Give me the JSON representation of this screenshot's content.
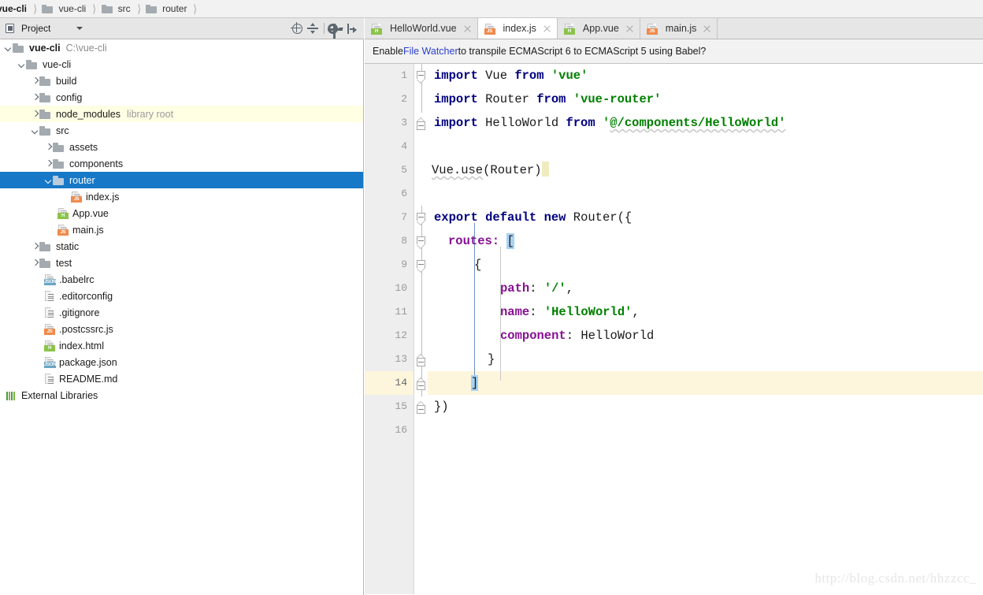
{
  "breadcrumb": {
    "items": [
      {
        "label": "vue-cli",
        "icon": "folder-icon",
        "root": true
      },
      {
        "label": "vue-cli",
        "icon": "folder-icon",
        "root": false
      },
      {
        "label": "src",
        "icon": "folder-icon",
        "root": false
      },
      {
        "label": "router",
        "icon": "folder-icon",
        "root": false
      }
    ]
  },
  "project_panel": {
    "title": "Project",
    "icons": {
      "panel": "project-panel-icon",
      "dropdown": "chevron-down-icon",
      "locate": "locate-target-icon",
      "collapse_all": "collapse-all-icon",
      "settings": "gear-icon",
      "settings_caret": "chevron-down-icon",
      "hide": "hide-panel-icon"
    },
    "tree": [
      {
        "label": "vue-cli",
        "note": "C:\\vue-cli",
        "indent": 0,
        "chevron": "down",
        "icon": "folder-icon",
        "bold": true,
        "state": "normal"
      },
      {
        "label": "vue-cli",
        "note": "",
        "indent": 1,
        "chevron": "down",
        "icon": "folder-icon",
        "bold": false,
        "state": "normal"
      },
      {
        "label": "build",
        "note": "",
        "indent": 2,
        "chevron": "right",
        "icon": "folder-icon",
        "bold": false,
        "state": "normal"
      },
      {
        "label": "config",
        "note": "",
        "indent": 2,
        "chevron": "right",
        "icon": "folder-icon",
        "bold": false,
        "state": "normal"
      },
      {
        "label": "node_modules",
        "note": "library root",
        "indent": 2,
        "chevron": "right",
        "icon": "folder-icon",
        "bold": false,
        "state": "tinted"
      },
      {
        "label": "src",
        "note": "",
        "indent": 2,
        "chevron": "down",
        "icon": "folder-icon",
        "bold": false,
        "state": "normal"
      },
      {
        "label": "assets",
        "note": "",
        "indent": 3,
        "chevron": "right",
        "icon": "folder-icon",
        "bold": false,
        "state": "normal"
      },
      {
        "label": "components",
        "note": "",
        "indent": 3,
        "chevron": "right",
        "icon": "folder-icon",
        "bold": false,
        "state": "normal"
      },
      {
        "label": "router",
        "note": "",
        "indent": 3,
        "chevron": "down",
        "icon": "folder-icon",
        "bold": false,
        "state": "selected"
      },
      {
        "label": "index.js",
        "note": "",
        "indent": 4,
        "chevron": "none",
        "icon": "js-file-icon",
        "bold": false,
        "state": "normal"
      },
      {
        "label": "App.vue",
        "note": "",
        "indent": 3,
        "chevron": "none",
        "icon": "vue-file-icon",
        "bold": false,
        "state": "normal"
      },
      {
        "label": "main.js",
        "note": "",
        "indent": 3,
        "chevron": "none",
        "icon": "js-file-icon",
        "bold": false,
        "state": "normal"
      },
      {
        "label": "static",
        "note": "",
        "indent": 2,
        "chevron": "right",
        "icon": "folder-icon",
        "bold": false,
        "state": "normal"
      },
      {
        "label": "test",
        "note": "",
        "indent": 2,
        "chevron": "right",
        "icon": "folder-icon",
        "bold": false,
        "state": "normal"
      },
      {
        "label": ".babelrc",
        "note": "",
        "indent": 2,
        "chevron": "none",
        "icon": "json-file-icon",
        "bold": false,
        "state": "normal"
      },
      {
        "label": ".editorconfig",
        "note": "",
        "indent": 2,
        "chevron": "none",
        "icon": "text-file-icon",
        "bold": false,
        "state": "normal"
      },
      {
        "label": ".gitignore",
        "note": "",
        "indent": 2,
        "chevron": "none",
        "icon": "text-file-icon",
        "bold": false,
        "state": "normal"
      },
      {
        "label": ".postcssrc.js",
        "note": "",
        "indent": 2,
        "chevron": "none",
        "icon": "js-file-icon",
        "bold": false,
        "state": "normal"
      },
      {
        "label": "index.html",
        "note": "",
        "indent": 2,
        "chevron": "none",
        "icon": "html-file-icon",
        "bold": false,
        "state": "normal"
      },
      {
        "label": "package.json",
        "note": "",
        "indent": 2,
        "chevron": "none",
        "icon": "json-file-icon",
        "bold": false,
        "state": "normal"
      },
      {
        "label": "README.md",
        "note": "",
        "indent": 2,
        "chevron": "none",
        "icon": "text-file-icon",
        "bold": false,
        "state": "normal"
      },
      {
        "label": "External Libraries",
        "note": "",
        "indent": 0,
        "chevron": "none",
        "icon": "external-libraries-icon",
        "bold": false,
        "state": "normal"
      }
    ]
  },
  "editor": {
    "tabs": [
      {
        "label": "HelloWorld.vue",
        "icon": "vue-file-icon",
        "active": false
      },
      {
        "label": "index.js",
        "icon": "js-file-icon",
        "active": true
      },
      {
        "label": "App.vue",
        "icon": "vue-file-icon",
        "active": false
      },
      {
        "label": "main.js",
        "icon": "js-file-icon",
        "active": false
      }
    ],
    "notification": {
      "prefix": "Enable ",
      "link": "File Watcher",
      "suffix": " to transpile ECMAScript 6 to ECMAScript 5 using Babel?"
    },
    "line_numbers": [
      "1",
      "2",
      "3",
      "4",
      "5",
      "6",
      "7",
      "8",
      "9",
      "10",
      "11",
      "12",
      "13",
      "14",
      "15",
      "16"
    ],
    "current_line": 14,
    "lines": [
      {
        "n": 1,
        "text": "import Vue from 'vue'"
      },
      {
        "n": 2,
        "text": "import Router from 'vue-router'"
      },
      {
        "n": 3,
        "text": "import HelloWorld from '@/components/HelloWorld'"
      },
      {
        "n": 4,
        "text": ""
      },
      {
        "n": 5,
        "text": "Vue.use(Router)"
      },
      {
        "n": 6,
        "text": ""
      },
      {
        "n": 7,
        "text": "export default new Router({"
      },
      {
        "n": 8,
        "text": "  routes: ["
      },
      {
        "n": 9,
        "text": "    {"
      },
      {
        "n": 10,
        "text": "      path: '/',"
      },
      {
        "n": 11,
        "text": "      name: 'HelloWorld',"
      },
      {
        "n": 12,
        "text": "      component: HelloWorld"
      },
      {
        "n": 13,
        "text": "    }"
      },
      {
        "n": 14,
        "text": "  ]"
      },
      {
        "n": 15,
        "text": "})"
      },
      {
        "n": 16,
        "text": ""
      }
    ],
    "tokens": {
      "l1": [
        {
          "t": "import",
          "c": "kw"
        },
        {
          "t": " Vue ",
          "c": "pln"
        },
        {
          "t": "from",
          "c": "kw"
        },
        {
          "t": " ",
          "c": "pln"
        },
        {
          "t": "'vue'",
          "c": "str"
        }
      ],
      "l2": [
        {
          "t": "import",
          "c": "kw"
        },
        {
          "t": " Router ",
          "c": "pln"
        },
        {
          "t": "from",
          "c": "kw"
        },
        {
          "t": " ",
          "c": "pln"
        },
        {
          "t": "'vue-router'",
          "c": "str"
        }
      ],
      "l3a": [
        {
          "t": "import",
          "c": "kw"
        },
        {
          "t": " HelloWorld ",
          "c": "pln"
        },
        {
          "t": "from",
          "c": "kw"
        },
        {
          "t": " ",
          "c": "pln"
        },
        {
          "t": "'",
          "c": "str"
        }
      ],
      "l3b": "@/components/HelloWorld'",
      "l5a": "Vue.use",
      "l5b": "(Router)",
      "l7": [
        {
          "t": "export",
          "c": "kw"
        },
        {
          "t": " ",
          "c": "pln"
        },
        {
          "t": "default",
          "c": "kw"
        },
        {
          "t": " ",
          "c": "pln"
        },
        {
          "t": "new",
          "c": "kw"
        },
        {
          "t": " Router({",
          "c": "pln"
        }
      ],
      "l8a": "routes:",
      "l8b": "[",
      "l9": "{",
      "l10a": "path",
      "l10b": ": ",
      "l10c": "'/'",
      "l10d": ",",
      "l11a": "name",
      "l11b": ": ",
      "l11c": "'HelloWorld'",
      "l11d": ",",
      "l12a": "component",
      "l12b": ": HelloWorld",
      "l13": "}",
      "l14": "]",
      "l15": "})"
    }
  },
  "watermark": {
    "text": "http://blog.csdn.net/hhzzcc_"
  },
  "colors": {
    "selection_blue": "#1878c8",
    "tinted_yellow": "#ffffe4",
    "current_line": "#fdf6dd",
    "keyword": "#000080",
    "string": "#008000",
    "property": "#871094",
    "link": "#2c3fd0",
    "panel_bg": "#e6e6e6"
  }
}
